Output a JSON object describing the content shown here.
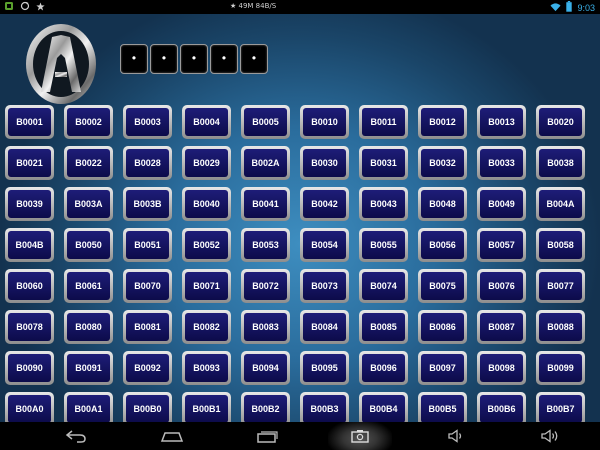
{
  "status_bar": {
    "left_icons": [
      "android-icon",
      "sync-icon",
      "star-icon"
    ],
    "center_text": "★ 49M  84B/S",
    "right_icons": [
      "wifi-icon",
      "battery-icon"
    ],
    "time": "9:03"
  },
  "logo": {
    "icon": "acura-logo"
  },
  "code_display": {
    "cells": [
      "•",
      "•",
      "•",
      "•",
      "•"
    ]
  },
  "code_buttons": [
    "B0001",
    "B0002",
    "B0003",
    "B0004",
    "B0005",
    "B0010",
    "B0011",
    "B0012",
    "B0013",
    "B0020",
    "B0021",
    "B0022",
    "B0028",
    "B0029",
    "B002A",
    "B0030",
    "B0031",
    "B0032",
    "B0033",
    "B0038",
    "B0039",
    "B003A",
    "B003B",
    "B0040",
    "B0041",
    "B0042",
    "B0043",
    "B0048",
    "B0049",
    "B004A",
    "B004B",
    "B0050",
    "B0051",
    "B0052",
    "B0053",
    "B0054",
    "B0055",
    "B0056",
    "B0057",
    "B0058",
    "B0060",
    "B0061",
    "B0070",
    "B0071",
    "B0072",
    "B0073",
    "B0074",
    "B0075",
    "B0076",
    "B0077",
    "B0078",
    "B0080",
    "B0081",
    "B0082",
    "B0083",
    "B0084",
    "B0085",
    "B0086",
    "B0087",
    "B0088",
    "B0090",
    "B0091",
    "B0092",
    "B0093",
    "B0094",
    "B0095",
    "B0096",
    "B0097",
    "B0098",
    "B0099",
    "B00A0",
    "B00A1",
    "B00B0",
    "B00B1",
    "B00B2",
    "B00B3",
    "B00B4",
    "B00B5",
    "B00B6",
    "B00B7"
  ],
  "nav_bar": {
    "icons": [
      "back-icon",
      "home-icon",
      "recent-apps-icon",
      "screenshot-icon",
      "volume-down-icon",
      "volume-up-icon"
    ]
  },
  "colors": {
    "button_face": "#15146a",
    "button_bezel": "#c8c8c8",
    "accent": "#3ab0e8"
  }
}
